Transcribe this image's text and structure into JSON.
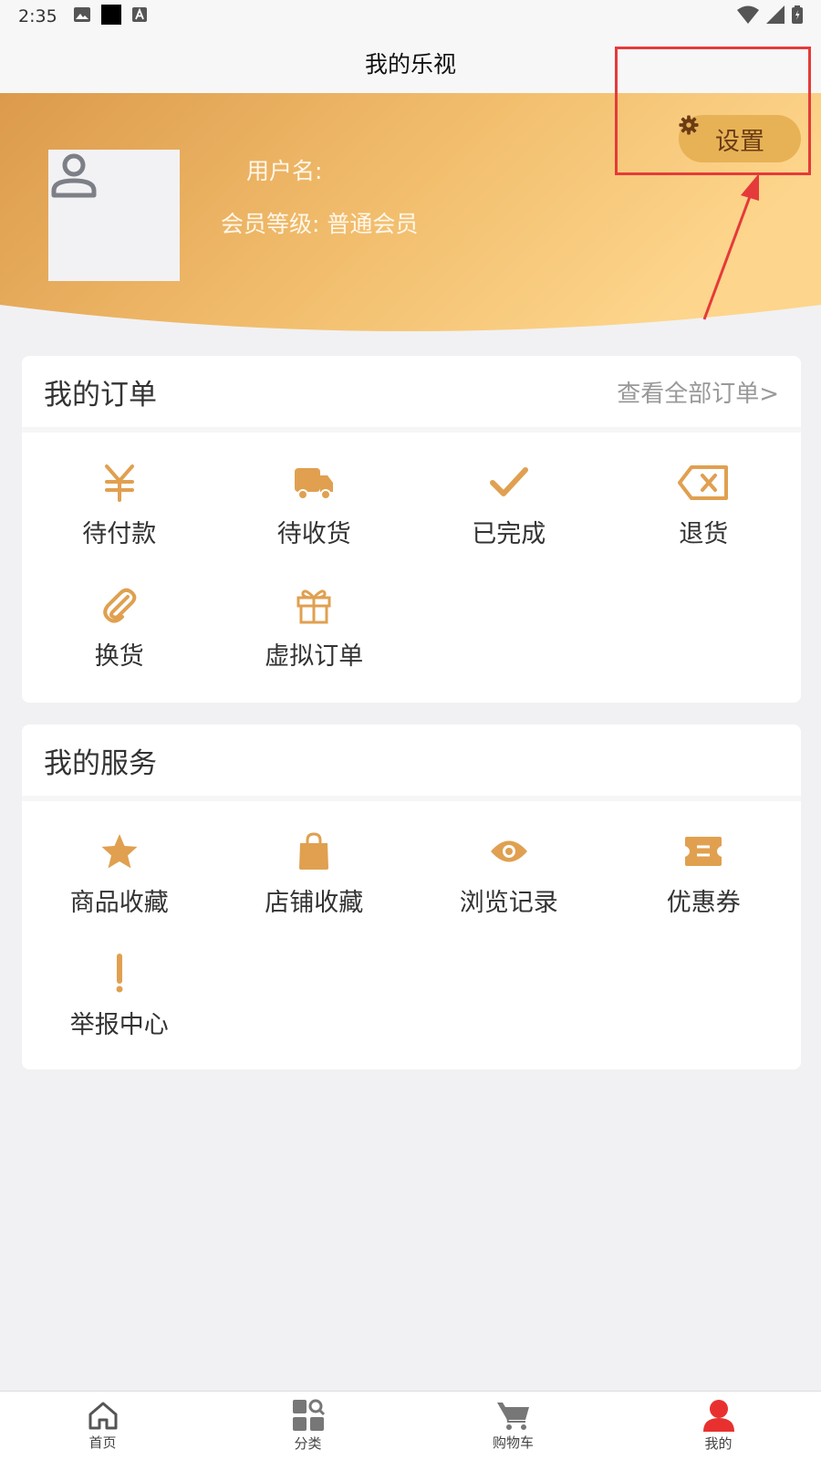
{
  "status_bar": {
    "time": "2:35"
  },
  "title": "我的乐视",
  "profile": {
    "username_label": "用户名:",
    "member_level_label": "会员等级:",
    "member_level_value": "普通会员",
    "settings_label": "设置"
  },
  "orders": {
    "title": "我的订单",
    "view_all": "查看全部订单>",
    "items": [
      {
        "label": "待付款",
        "icon": "yen-icon"
      },
      {
        "label": "待收货",
        "icon": "truck-icon"
      },
      {
        "label": "已完成",
        "icon": "check-icon"
      },
      {
        "label": "退货",
        "icon": "backspace-x-icon"
      },
      {
        "label": "换货",
        "icon": "paperclip-icon"
      },
      {
        "label": "虚拟订单",
        "icon": "gift-icon"
      }
    ]
  },
  "services": {
    "title": "我的服务",
    "items": [
      {
        "label": "商品收藏",
        "icon": "star-icon"
      },
      {
        "label": "店铺收藏",
        "icon": "bag-icon"
      },
      {
        "label": "浏览记录",
        "icon": "eye-icon"
      },
      {
        "label": "优惠券",
        "icon": "ticket-icon"
      },
      {
        "label": "举报中心",
        "icon": "exclamation-icon"
      }
    ]
  },
  "tabs": [
    {
      "label": "首页",
      "icon": "home-icon"
    },
    {
      "label": "分类",
      "icon": "category-icon"
    },
    {
      "label": "购物车",
      "icon": "cart-icon"
    },
    {
      "label": "我的",
      "icon": "user-icon"
    }
  ],
  "colors": {
    "accent": "#e0a050",
    "annotation": "#e53a3a",
    "active_tab": "#e8312f",
    "gradient_start": "#dc9a4c",
    "gradient_end": "#fdd58c"
  }
}
